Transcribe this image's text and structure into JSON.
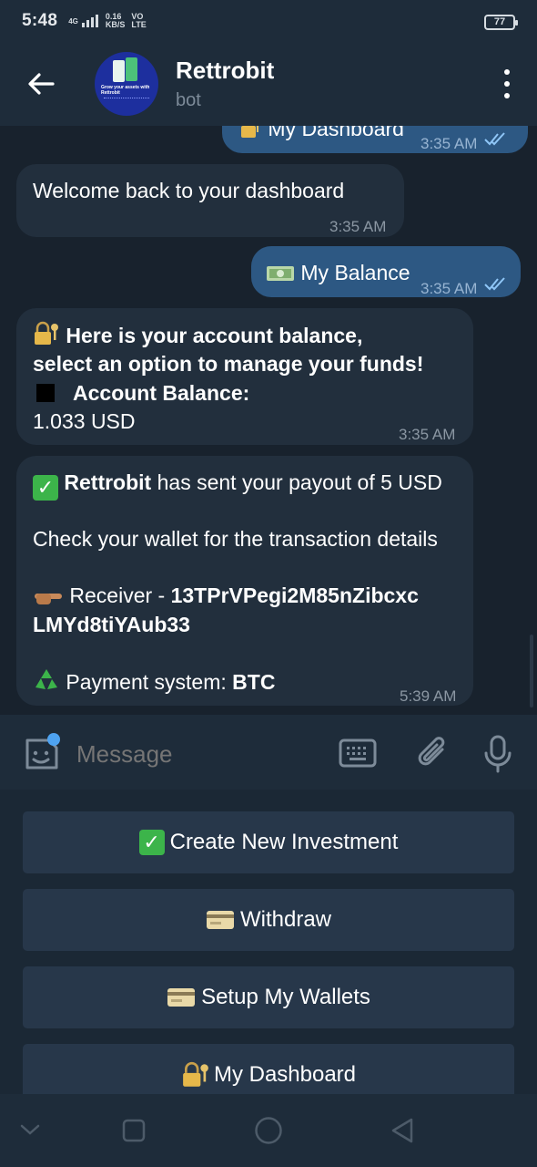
{
  "status_bar": {
    "time": "5:48",
    "net_top": "0.16",
    "net_bottom": "KB/S",
    "carrier": "VO",
    "network": "LTE",
    "signal_label": "4G",
    "battery": "77"
  },
  "header": {
    "title": "Rettrobit",
    "subtitle": "bot",
    "avatar_text": "Grow your assets with Rettrobit"
  },
  "messages": [
    {
      "dir": "out",
      "text": "My Dashboard",
      "time": "3:35 AM"
    },
    {
      "dir": "in",
      "text": "Welcome back to your dashboard",
      "time": "3:35 AM"
    },
    {
      "dir": "out",
      "text": "My Balance",
      "time": "3:35 AM"
    },
    {
      "dir": "in",
      "line1": "Here is your account balance,",
      "line2": "select an option to manage your funds!",
      "line3": "Account  Balance:",
      "line4": "1.033 USD",
      "time": "3:35 AM"
    },
    {
      "dir": "in",
      "sender": "Rettrobit",
      "payout": "has sent your payout of 5 USD",
      "check": "Check your wallet for the transaction details",
      "receiver_label": "Receiver - ",
      "receiver_addr1": "13TPrVPegi2M85nZibcxc",
      "receiver_addr2": "LMYd8tiYAub33",
      "system_label": "Payment system: ",
      "system_value": "BTC",
      "time": "5:39 AM"
    }
  ],
  "input": {
    "placeholder": "Message"
  },
  "keyboard_buttons": [
    {
      "label": "Create New Investment",
      "icon": "check-emoji"
    },
    {
      "label": "Withdraw",
      "icon": "credit-card-emoji"
    },
    {
      "label": "Setup My Wallets",
      "icon": "credit-card-emoji"
    },
    {
      "label": "My Dashboard",
      "icon": "lock-key-emoji"
    }
  ],
  "colors": {
    "header_bg": "#1e2c3a",
    "chat_bg": "#18222d",
    "incoming_bubble": "#222f3d",
    "outgoing_bubble": "#2d5883",
    "keyboard_button": "#27374a",
    "accent": "#4ea3f1"
  }
}
